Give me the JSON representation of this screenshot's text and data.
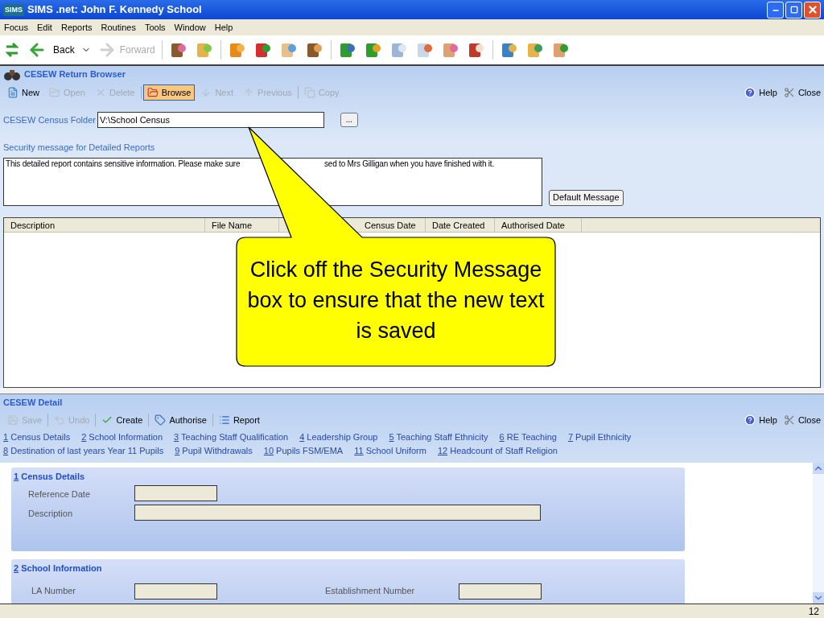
{
  "window": {
    "title": "SIMS .net: John F. Kennedy School",
    "app_badge": "SIMS"
  },
  "menu": [
    {
      "label": "Focus"
    },
    {
      "label": "Edit"
    },
    {
      "label": "Reports"
    },
    {
      "label": "Routines"
    },
    {
      "label": "Tools"
    },
    {
      "label": "Window"
    },
    {
      "label": "Help"
    }
  ],
  "nav": {
    "back": {
      "label": "Back",
      "disabled": false
    },
    "forward": {
      "label": "Forward",
      "disabled": true
    }
  },
  "browser": {
    "title": "CESEW Return Browser",
    "toolbar": [
      {
        "kind": "new",
        "label": "New",
        "disabled": false,
        "pressed": false
      },
      {
        "kind": "open",
        "label": "Open",
        "disabled": true,
        "pressed": false
      },
      {
        "kind": "delete",
        "label": "Delete",
        "disabled": true,
        "pressed": false
      },
      {
        "kind": "browse",
        "label": "Browse",
        "disabled": false,
        "pressed": true
      },
      {
        "kind": "next",
        "label": "Next",
        "disabled": true,
        "pressed": false
      },
      {
        "kind": "previous",
        "label": "Previous",
        "disabled": true,
        "pressed": false
      },
      {
        "kind": "copy",
        "label": "Copy",
        "disabled": true,
        "pressed": false
      }
    ],
    "help": "Help",
    "close": "Close",
    "folder": {
      "label": "CESEW Census Folder",
      "value": "V:\\School Census",
      "browse": "..."
    },
    "security": {
      "label": "Security message for Detailed Reports",
      "message_parts": [
        "This detailed report contains sensitive information.  Please make sure",
        "sed to Mrs Gilligan when you have finished with it."
      ],
      "default_button": "Default Message"
    },
    "table": {
      "columns": [
        "Description",
        "File Name",
        "Census Date",
        "Date Created",
        "Authorised Date"
      ]
    }
  },
  "detail": {
    "title": "CESEW Detail",
    "toolbar": [
      {
        "kind": "save",
        "label": "Save",
        "disabled": true
      },
      {
        "kind": "undo",
        "label": "Undo",
        "disabled": true
      },
      {
        "kind": "create",
        "label": "Create",
        "disabled": false
      },
      {
        "kind": "authorise",
        "label": "Authorise",
        "disabled": false
      },
      {
        "kind": "report",
        "label": "Report",
        "disabled": false
      }
    ],
    "help": "Help",
    "close": "Close",
    "links": [
      [
        {
          "number": "1",
          "label": "Census Details"
        },
        {
          "number": "2",
          "label": "School Information"
        },
        {
          "number": "3",
          "label": "Teaching Staff Qualification"
        },
        {
          "number": "4",
          "label": "Leadership Group"
        },
        {
          "number": "5",
          "label": "Teaching Staff Ethnicity"
        },
        {
          "number": "6",
          "label": "RE Teaching"
        },
        {
          "number": "7",
          "label": "Pupil Ethnicity"
        }
      ],
      [
        {
          "number": "8",
          "label": "Destination of last years Year 11 Pupils"
        },
        {
          "number": "9",
          "label": "Pupil Withdrawals"
        },
        {
          "number": "10",
          "label": "Pupils FSM/EMA"
        },
        {
          "number": "11",
          "label": "School Uniform"
        },
        {
          "number": "12",
          "label": "Headcount of Staff Religion"
        }
      ]
    ],
    "sections": [
      {
        "number": "1",
        "title": "Census Details",
        "fields": [
          {
            "label": "Reference Date",
            "kind": "short"
          },
          {
            "label": "Description",
            "kind": "long"
          }
        ]
      },
      {
        "number": "2",
        "title": "School Information",
        "fields": [
          {
            "label": "LA Number",
            "kind": "short"
          },
          {
            "label": "Establishment Number",
            "kind": "short"
          }
        ]
      }
    ]
  },
  "status_bar": {
    "page": "12"
  },
  "callout": {
    "text": "Click off the Security Message box to ensure that the new text is saved"
  }
}
